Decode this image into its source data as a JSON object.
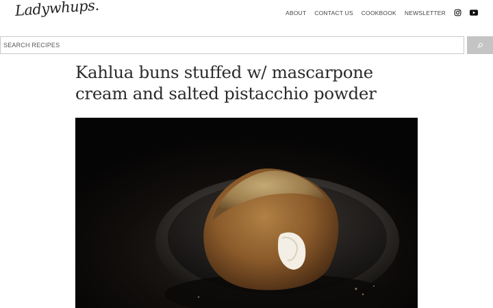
{
  "header": {
    "logo_text": "Ladywhups.",
    "nav": [
      {
        "label": "ABOUT"
      },
      {
        "label": "CONTACT US"
      },
      {
        "label": "COOKBOOK"
      },
      {
        "label": "NEWSLETTER"
      }
    ],
    "social_icons": [
      "instagram-icon",
      "youtube-icon"
    ]
  },
  "search": {
    "placeholder": "SEARCH RECIPES",
    "button_icon": "search-icon"
  },
  "article": {
    "title": "Kahlua buns stuffed w/ mascarpone cream and salted pistacchio powder",
    "image_subject": "kahlua-bun-in-dark-bowl"
  },
  "colors": {
    "search_button_bg": "#c4c4c4",
    "text": "#2b2b2b",
    "photo_bg": "#0e0c0b"
  }
}
